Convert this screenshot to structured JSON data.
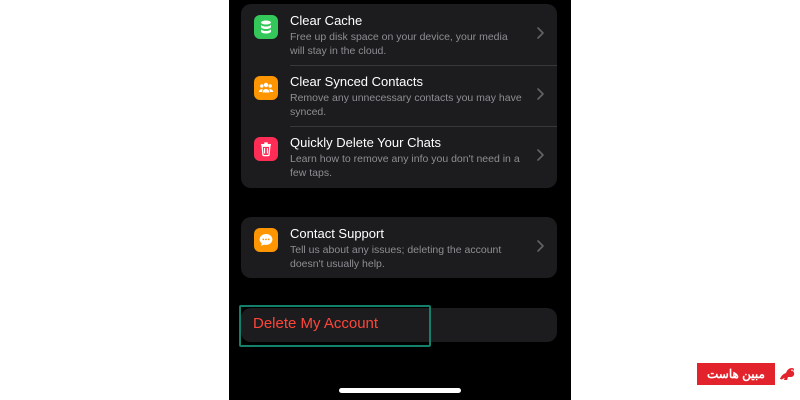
{
  "rows": [
    {
      "title": "Clear Cache",
      "subtitle": "Free up disk space on your device, your media will stay in the cloud.",
      "icon": "database-icon",
      "icon_color": "#34c759"
    },
    {
      "title": "Clear Synced Contacts",
      "subtitle": "Remove any unnecessary contacts you may have synced.",
      "icon": "people-icon",
      "icon_color": "#ff9500"
    },
    {
      "title": "Quickly Delete Your Chats",
      "subtitle": "Learn how to remove any info you don't need in a few taps.",
      "icon": "trash-icon",
      "icon_color": "#ff2d55"
    }
  ],
  "support": {
    "title": "Contact Support",
    "subtitle": "Tell us about any issues; deleting the account doesn't usually help.",
    "icon": "chat-bubble-icon",
    "icon_color": "#ff9500"
  },
  "delete_account": {
    "label": "Delete My Account",
    "color": "#ff453a"
  },
  "highlight_color": "#13806b",
  "watermark": {
    "text": "مبین هاست",
    "color": "#e2232b"
  }
}
